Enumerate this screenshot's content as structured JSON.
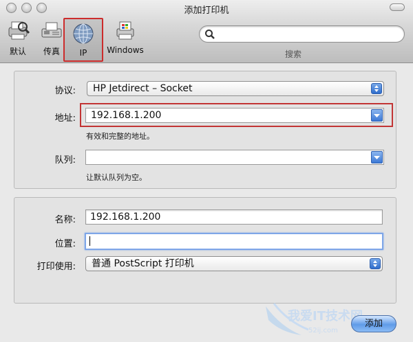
{
  "window": {
    "title": "添加打印机"
  },
  "toolbar": {
    "default_label": "默认",
    "fax_label": "传真",
    "ip_label": "IP",
    "windows_label": "Windows",
    "search_caption": "搜索",
    "search_value": ""
  },
  "form": {
    "protocol_label": "协议:",
    "protocol_value": "HP Jetdirect – Socket",
    "address_label": "地址:",
    "address_value": "192.168.1.200",
    "address_hint": "有效和完整的地址。",
    "queue_label": "队列:",
    "queue_value": "",
    "queue_hint": "让默认队列为空。",
    "name_label": "名称:",
    "name_value": "192.168.1.200",
    "location_label": "位置:",
    "location_value": "",
    "print_using_label": "打印使用:",
    "print_using_value": "普通 PostScript 打印机"
  },
  "buttons": {
    "add_label": "添加"
  },
  "watermark": {
    "text": "我爱IT技术网",
    "url": "52ij.com"
  },
  "colors": {
    "highlight": "#c23434",
    "accent": "#3d79d6"
  }
}
